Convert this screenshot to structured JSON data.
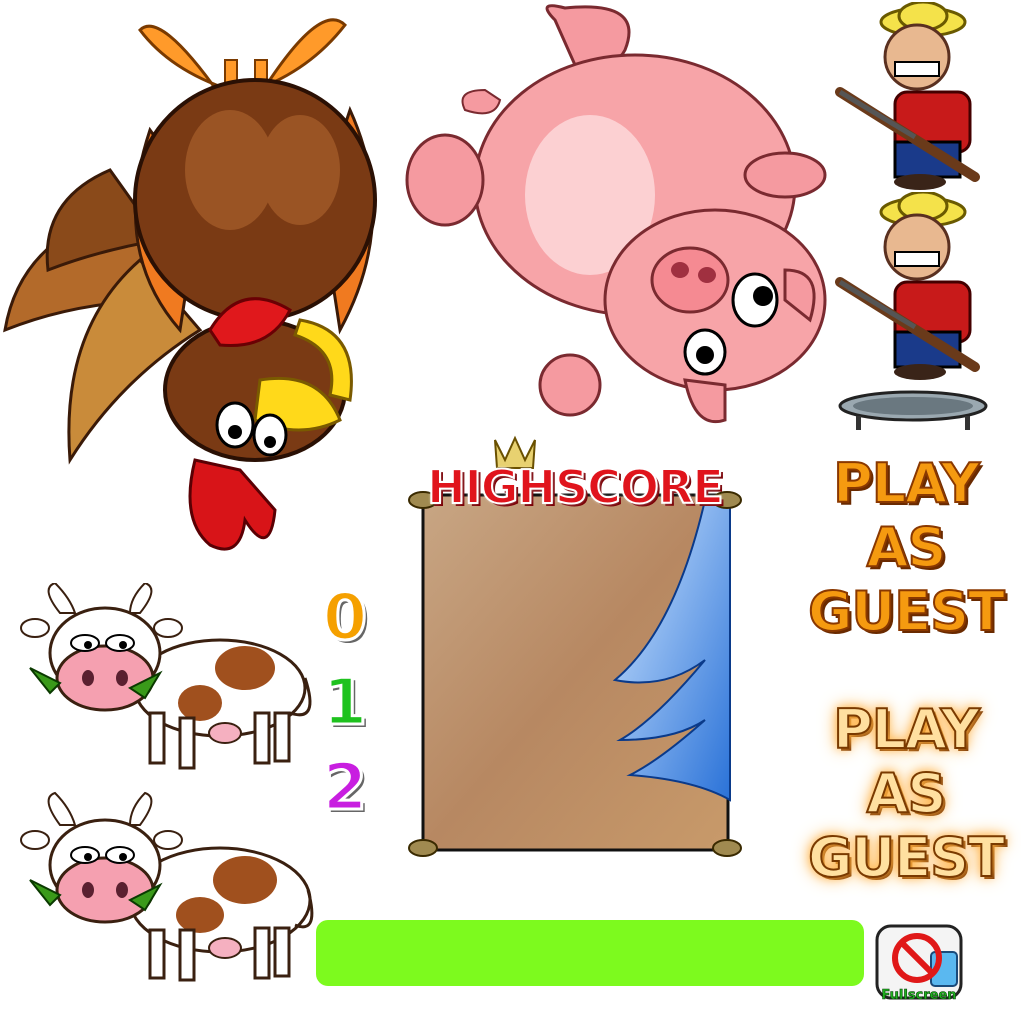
{
  "highscore": {
    "title": "HIGHSCORE"
  },
  "digits": [
    "0",
    "1",
    "2"
  ],
  "guest_buttons": [
    {
      "label": "PLAY\nAS\nGUEST",
      "state": "normal"
    },
    {
      "label": "PLAY\nAS\nGUEST",
      "state": "hover"
    }
  ],
  "name_bar": {
    "value": "",
    "color": "#7dfa1e"
  },
  "fullscreen": {
    "label": "Fullscreen",
    "icon": "no-fullscreen-icon"
  }
}
